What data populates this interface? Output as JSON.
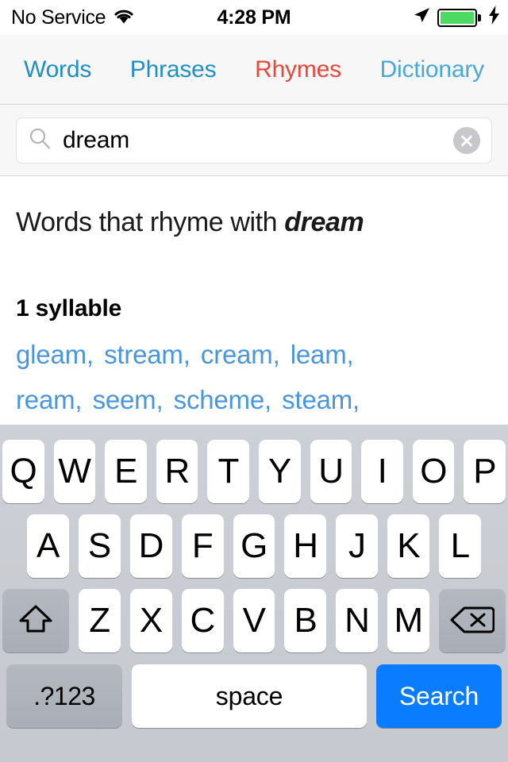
{
  "status_bar": {
    "carrier": "No Service",
    "wifi_icon": "wifi-icon",
    "time": "4:28 PM",
    "location_icon": "location-arrow-icon",
    "battery_icon": "battery-icon",
    "battery_level_percent": 100,
    "battery_color": "#4cd964",
    "charging_icon": "lightning-bolt-icon"
  },
  "tabs": [
    {
      "label": "Words",
      "color": "#1f8fc4",
      "active": false
    },
    {
      "label": "Phrases",
      "color": "#1f8fc4",
      "active": false
    },
    {
      "label": "Rhymes",
      "color": "#e8473c",
      "active": true
    },
    {
      "label": "Dictionary",
      "color": "#4aa8d8",
      "active": false
    }
  ],
  "search": {
    "value": "dream",
    "placeholder": "Search",
    "search_icon": "search-icon",
    "clear_icon": "clear-circle-icon"
  },
  "content": {
    "heading_prefix": "Words that rhyme with ",
    "heading_term": "dream",
    "section_heading": "1 syllable",
    "separator": ",",
    "link_color": "#4a96dd",
    "rows": [
      [
        "gleam",
        "stream",
        "cream",
        "leam"
      ],
      [
        "ream",
        "seem",
        "scheme",
        "steam"
      ]
    ]
  },
  "keyboard": {
    "row1": [
      "Q",
      "W",
      "E",
      "R",
      "T",
      "Y",
      "U",
      "I",
      "O",
      "P"
    ],
    "row2": [
      "A",
      "S",
      "D",
      "F",
      "G",
      "H",
      "J",
      "K",
      "L"
    ],
    "row3": [
      "Z",
      "X",
      "C",
      "V",
      "B",
      "N",
      "M"
    ],
    "shift_icon": "shift-arrow-icon",
    "delete_icon": "backspace-delete-icon",
    "numbers_label": ".?123",
    "space_label": "space",
    "search_label": "Search",
    "search_key_color": "#0a7cff"
  }
}
